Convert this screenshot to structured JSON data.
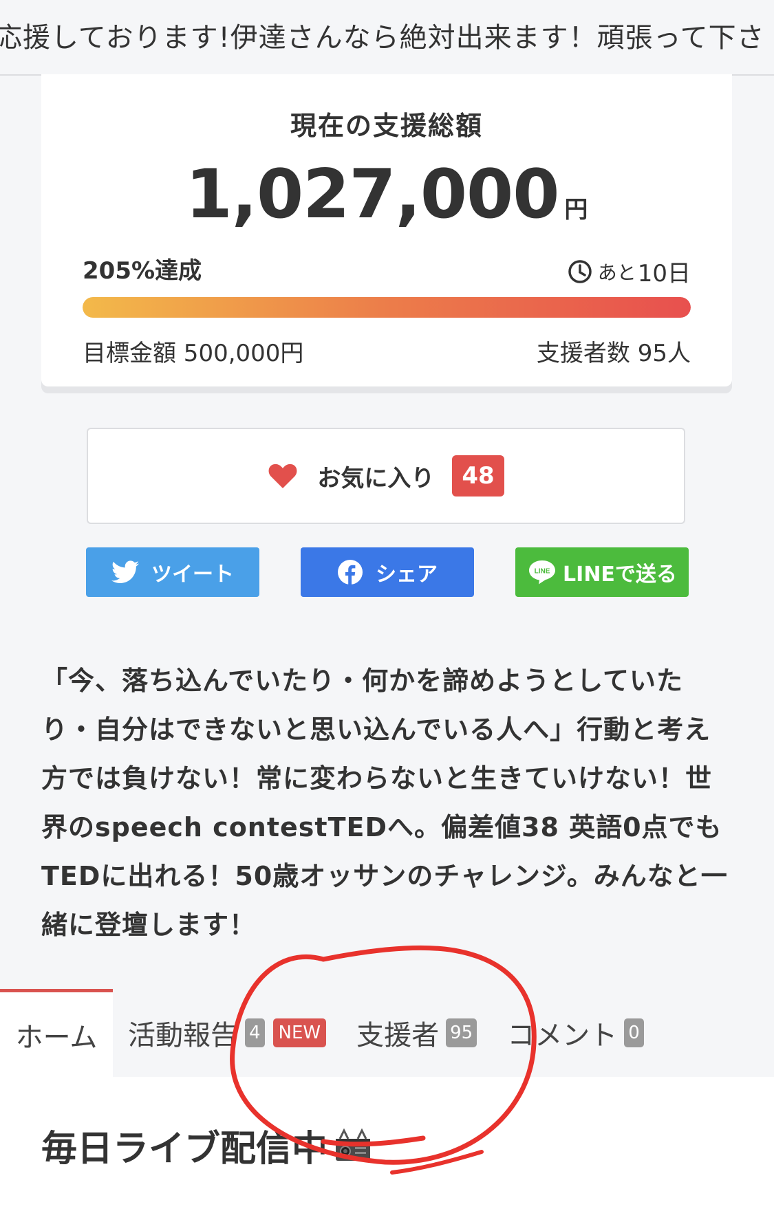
{
  "ticker": {
    "text": "応援しております!伊達さんなら絶対出来ます！頑張って下さ"
  },
  "funding": {
    "label": "現在の支援総額",
    "amount": "1,027,000",
    "currency": "円",
    "achievement": "205%達成",
    "remaining_prefix": "あと",
    "remaining_days": "10日",
    "progress_percent": 100,
    "goal": "目標金額 500,000円",
    "backers": "支援者数 95人"
  },
  "favorite": {
    "label": "お気に入り",
    "count": "48",
    "icon": "heart-icon"
  },
  "share": {
    "tweet_label": "ツイート",
    "facebook_label": "シェア",
    "line_label": "LINEで送る",
    "line_logo_text": "LINE"
  },
  "description": "「今、落ち込んでいたり・何かを諦めようとしていたり・自分はできないと思い込んでいる人へ」行動と考え方では負けない！常に変わらないと生きていけない！世界のspeech contestTEDへ。偏差値38 英語0点でもTEDに出れる！50歳オッサンのチャレンジ。みんなと一緒に登壇します！",
  "tabs": {
    "home": "ホーム",
    "activity": "活動報告",
    "activity_count": "4",
    "activity_new": "NEW",
    "supporters": "支援者",
    "supporters_count": "95",
    "comments": "コメント",
    "comments_count": "0"
  },
  "section": {
    "heading": "毎日ライブ配信中"
  },
  "colors": {
    "accent_red": "#e2504c",
    "twitter": "#4aa0e8",
    "facebook": "#3b78e7",
    "line": "#4cbb3d",
    "annotation": "#e8322c"
  }
}
